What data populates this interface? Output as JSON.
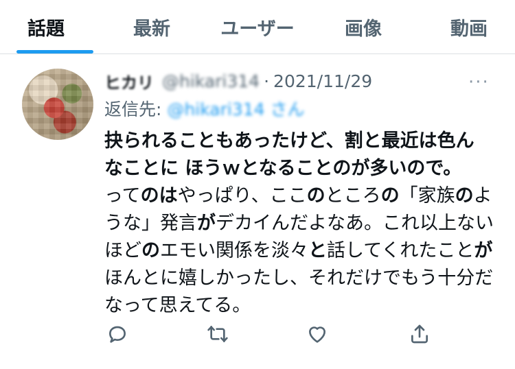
{
  "tabs": [
    {
      "label": "話題",
      "active": true
    },
    {
      "label": "最新",
      "active": false
    },
    {
      "label": "ユーザー",
      "active": false
    },
    {
      "label": "画像",
      "active": false
    },
    {
      "label": "動画",
      "active": false
    }
  ],
  "tweet": {
    "display_name": "ヒカリ",
    "handle": "@hikari314",
    "separator": "·",
    "date": "2021/11/29",
    "more_label": "···",
    "reply_label": "返信先:",
    "reply_target": "@hikari314 さん",
    "quote_line1": "抉られることもあったけど、割と最近は色ん",
    "quote_line2": "なことに ほうｗとなることのが多いので。",
    "body": [
      {
        "t": "って",
        "b": false
      },
      {
        "t": "のは",
        "b": true
      },
      {
        "t": "やっぱり、ここ",
        "b": false
      },
      {
        "t": "の",
        "b": true
      },
      {
        "t": "ところ",
        "b": false
      },
      {
        "t": "の",
        "b": true
      },
      {
        "t": "「家族",
        "b": false
      },
      {
        "t": "の",
        "b": true
      },
      {
        "t": "ような」発言",
        "b": false
      },
      {
        "t": "が",
        "b": true
      },
      {
        "t": "デカイんだよなあ。これ以上ないほど",
        "b": false
      },
      {
        "t": "の",
        "b": true
      },
      {
        "t": "エモい関係を淡々",
        "b": false
      },
      {
        "t": "と",
        "b": true
      },
      {
        "t": "話してくれたこと",
        "b": false
      },
      {
        "t": "が",
        "b": true
      },
      {
        "t": "ほんとに嬉しかったし、それだけでもう十分だなって思えてる。",
        "b": false
      }
    ]
  },
  "actions": [
    {
      "name": "reply-icon"
    },
    {
      "name": "retweet-icon"
    },
    {
      "name": "like-icon"
    },
    {
      "name": "share-icon"
    }
  ],
  "colors": {
    "accent": "#1d9bf0",
    "muted": "#536471",
    "text": "#0f1419"
  }
}
